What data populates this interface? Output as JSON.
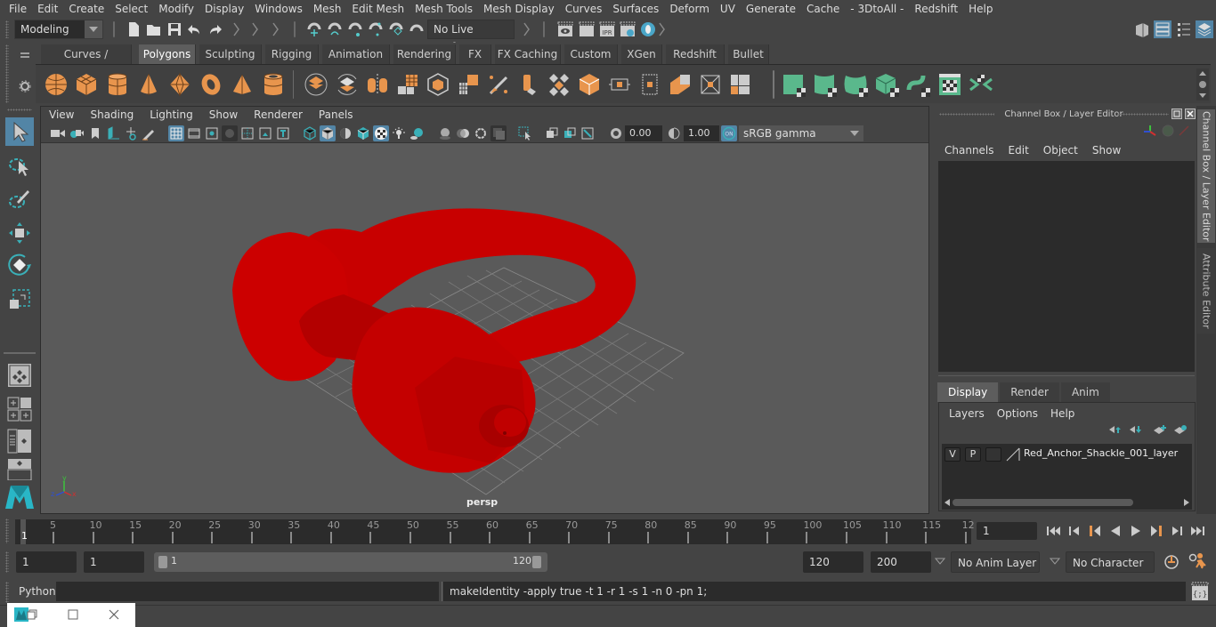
{
  "menubar": {
    "items": [
      "File",
      "Edit",
      "Create",
      "Select",
      "Modify",
      "Display",
      "Windows",
      "Mesh",
      "Edit Mesh",
      "Mesh Tools",
      "Mesh Display",
      "Curves",
      "Surfaces",
      "Deform",
      "UV",
      "Generate",
      "Cache",
      "- 3DtoAll -",
      "Redshift",
      "Help"
    ]
  },
  "statusline": {
    "workspace": "Modeling",
    "live_surface": "No Live Surface",
    "icons": [
      "new-scene-icon",
      "open-scene-icon",
      "save-scene-icon",
      "undo-icon",
      "redo-icon",
      "snap-grid-icon",
      "snap-curve-icon",
      "snap-point-icon",
      "snap-view-plane-icon",
      "snap-surface-icon",
      "make-live-icon",
      "render-view-icon",
      "render-frame-icon",
      "ipr-render-icon",
      "render-settings-icon",
      "hypershade-icon"
    ],
    "right_icons": [
      "modeling-toolkit-icon",
      "attribute-editor-toggle-icon",
      "tool-settings-toggle-icon",
      "channel-box-toggle-icon"
    ]
  },
  "shelf": {
    "tabs": [
      "Curves / Surfaces",
      "Polygons",
      "Sculpting",
      "Rigging",
      "Animation",
      "Rendering",
      "FX",
      "FX Caching",
      "Custom",
      "XGen",
      "Redshift",
      "Bullet"
    ],
    "active_tab": "Polygons",
    "orange_icons": [
      "poly-sphere-icon",
      "poly-cube-icon",
      "poly-cylinder-icon",
      "poly-cone-icon",
      "poly-platonic-icon",
      "poly-torus-icon",
      "poly-pyramid-icon",
      "poly-pipe-icon",
      "combine-icon",
      "separate-icon",
      "mirror-icon",
      "smooth-icon",
      "triangulate-icon",
      "quadrangulate-icon",
      "multi-cut-icon",
      "extrude-icon",
      "bridge-icon",
      "bevel-icon",
      "append-icon",
      "merge-icon",
      "fill-hole-icon",
      "wedge-icon",
      "merge-to-center-icon",
      "split-icon"
    ],
    "green_icons": [
      "planar-mapping-icon",
      "cylindrical-mapping-icon",
      "spherical-mapping-icon",
      "automatic-mapping-icon",
      "contour-stretch-icon",
      "uv-editor-icon",
      "unfold-icon"
    ]
  },
  "toolbox": {
    "tools": [
      "select-tool",
      "lasso-tool",
      "paint-select-tool",
      "move-tool",
      "rotate-tool",
      "scale-tool"
    ],
    "layouts": [
      "single-pane-layout",
      "four-pane-layout",
      "outliner-persp-layout",
      "graph-persp-layout"
    ]
  },
  "viewport": {
    "menu": [
      "View",
      "Shading",
      "Lighting",
      "Show",
      "Renderer",
      "Panels"
    ],
    "exposure": "0.00",
    "gamma": "1.00",
    "color_management": "ON",
    "color_space": "sRGB gamma",
    "camera_label": "persp",
    "object_color": "#cc0000",
    "axis": {
      "x": "x",
      "y": "y",
      "z": "z"
    }
  },
  "channel_box": {
    "title": "Channel Box / Layer Editor",
    "menu": [
      "Channels",
      "Edit",
      "Object",
      "Show"
    ]
  },
  "layer_editor": {
    "tabs": [
      "Display",
      "Render",
      "Anim"
    ],
    "active_tab": "Display",
    "menu": [
      "Layers",
      "Options",
      "Help"
    ],
    "layers": [
      {
        "visible": "V",
        "playback": "P",
        "name": "Red_Anchor_Shackle_001_layer"
      }
    ]
  },
  "side_tabs": [
    "Channel Box / Layer Editor",
    "Attribute Editor"
  ],
  "timeline": {
    "start_label": "1",
    "ticks": [
      "5",
      "10",
      "15",
      "20",
      "25",
      "30",
      "35",
      "40",
      "45",
      "50",
      "55",
      "60",
      "65",
      "70",
      "75",
      "80",
      "85",
      "90",
      "95",
      "100",
      "105",
      "110",
      "115",
      "12"
    ],
    "current_frame": "1"
  },
  "range": {
    "start": "1",
    "playback_start": "1",
    "slider_start": "1",
    "slider_end": "120",
    "playback_end": "120",
    "end": "200",
    "anim_layer": "No Anim Layer",
    "character_set": "No Character Set"
  },
  "command_line": {
    "language": "Python",
    "input": "",
    "result": "makeIdentity -apply true -t 1 -r 1 -s 1 -n 0 -pn 1;"
  }
}
